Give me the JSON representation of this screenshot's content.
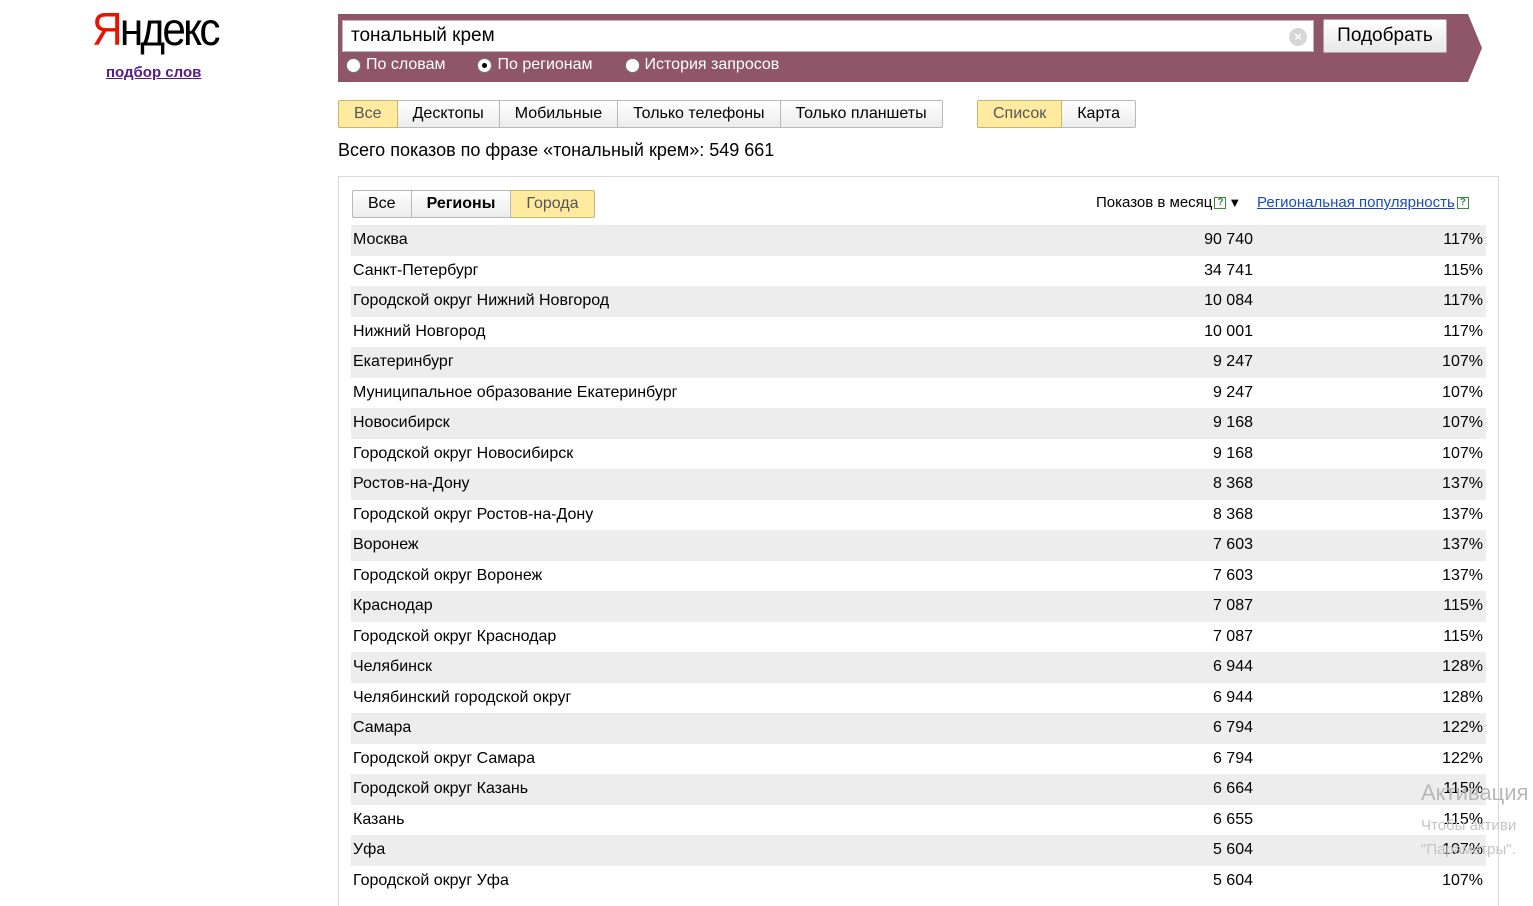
{
  "logo": {
    "first_letter": "Я",
    "rest": "ндекс"
  },
  "service_link": "подбор слов",
  "search": {
    "value": "тональный крем",
    "clear_icon": "clear-circle-icon",
    "button_label": "Подобрать",
    "modes": [
      {
        "label": "По словам",
        "selected": false
      },
      {
        "label": "По регионам",
        "selected": true
      },
      {
        "label": "История запросов",
        "selected": false
      }
    ]
  },
  "device_tabs": [
    {
      "label": "Все",
      "active": true
    },
    {
      "label": "Десктопы",
      "active": false
    },
    {
      "label": "Мобильные",
      "active": false
    },
    {
      "label": "Только телефоны",
      "active": false
    },
    {
      "label": "Только планшеты",
      "active": false
    }
  ],
  "view_tabs": [
    {
      "label": "Список",
      "active": true
    },
    {
      "label": "Карта",
      "active": false
    }
  ],
  "total_text": "Всего показов по фразе «тональный крем»: 549 661",
  "region_tabs": [
    {
      "label": "Все",
      "active": false
    },
    {
      "label": "Регионы",
      "active": false
    },
    {
      "label": "Города",
      "active": true
    }
  ],
  "columns": {
    "shows": "Показов в месяц",
    "popularity": "Региональная популярность",
    "help_glyph": "?",
    "sort_glyph": "▼"
  },
  "rows": [
    {
      "name": "Москва",
      "shows": "90 740",
      "pct": "117%"
    },
    {
      "name": "Санкт-Петербург",
      "shows": "34 741",
      "pct": "115%"
    },
    {
      "name": "Городской округ Нижний Новгород",
      "shows": "10 084",
      "pct": "117%"
    },
    {
      "name": "Нижний Новгород",
      "shows": "10 001",
      "pct": "117%"
    },
    {
      "name": "Екатеринбург",
      "shows": "9 247",
      "pct": "107%"
    },
    {
      "name": "Муниципальное образование Екатеринбург",
      "shows": "9 247",
      "pct": "107%"
    },
    {
      "name": "Новосибирск",
      "shows": "9 168",
      "pct": "107%"
    },
    {
      "name": "Городской округ Новосибирск",
      "shows": "9 168",
      "pct": "107%"
    },
    {
      "name": "Ростов-на-Дону",
      "shows": "8 368",
      "pct": "137%"
    },
    {
      "name": "Городской округ Ростов-на-Дону",
      "shows": "8 368",
      "pct": "137%"
    },
    {
      "name": "Воронеж",
      "shows": "7 603",
      "pct": "137%"
    },
    {
      "name": "Городской округ Воронеж",
      "shows": "7 603",
      "pct": "137%"
    },
    {
      "name": "Краснодар",
      "shows": "7 087",
      "pct": "115%"
    },
    {
      "name": "Городской округ Краснодар",
      "shows": "7 087",
      "pct": "115%"
    },
    {
      "name": "Челябинск",
      "shows": "6 944",
      "pct": "128%"
    },
    {
      "name": "Челябинский городской округ",
      "shows": "6 944",
      "pct": "128%"
    },
    {
      "name": "Самара",
      "shows": "6 794",
      "pct": "122%"
    },
    {
      "name": "Городской округ Самара",
      "shows": "6 794",
      "pct": "122%"
    },
    {
      "name": "Городской округ Казань",
      "shows": "6 664",
      "pct": "115%"
    },
    {
      "name": "Казань",
      "shows": "6 655",
      "pct": "115%"
    },
    {
      "name": "Уфа",
      "shows": "5 604",
      "pct": "107%"
    },
    {
      "name": "Городской округ Уфа",
      "shows": "5 604",
      "pct": "107%"
    }
  ],
  "watermark": {
    "line1": "Активация",
    "line2": "Чтобы активи",
    "line3": "\"Параметры\"."
  },
  "colors": {
    "band": "#8f5568",
    "active_tab": "#ffeba0",
    "logo_red": "#e61400",
    "link": "#1a4db3"
  }
}
